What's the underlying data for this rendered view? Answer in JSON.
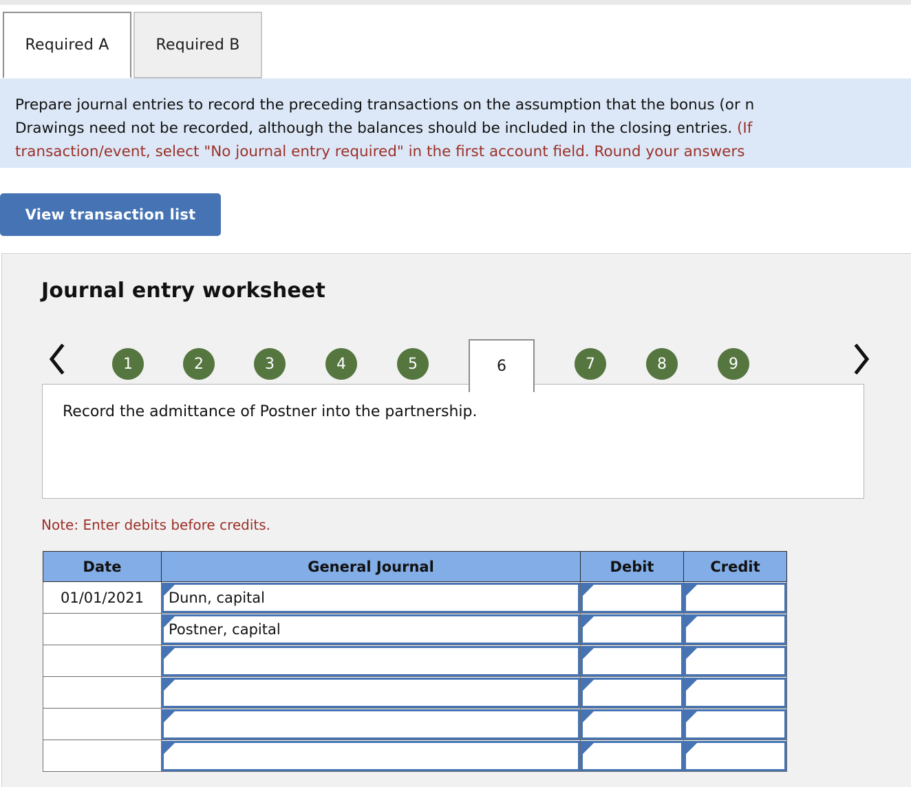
{
  "tabs": [
    {
      "label": "Required A",
      "active": true
    },
    {
      "label": "Required B",
      "active": false
    }
  ],
  "instructions": {
    "line1_plain": "Prepare journal entries to record the preceding transactions on the assumption that the bonus (or n",
    "line2_plain": "Drawings need not be recorded, although the balances should be included in the closing entries. ",
    "line2_highlight": "(If",
    "line3_highlight": "transaction/event, select \"No journal entry required\" in the first account field. Round your answers"
  },
  "toolbar": {
    "view_transaction_list": "View transaction list"
  },
  "worksheet": {
    "title": "Journal entry worksheet",
    "prev_icon": "chevron-left-icon",
    "next_icon": "chevron-right-icon",
    "pages": [
      {
        "label": "1",
        "active": false
      },
      {
        "label": "2",
        "active": false
      },
      {
        "label": "3",
        "active": false
      },
      {
        "label": "4",
        "active": false
      },
      {
        "label": "5",
        "active": false
      },
      {
        "label": "6",
        "active": true
      },
      {
        "label": "7",
        "active": false
      },
      {
        "label": "8",
        "active": false
      },
      {
        "label": "9",
        "active": false
      }
    ],
    "description": "Record the admittance of Postner into the partnership.",
    "note": "Note: Enter debits before credits."
  },
  "journal": {
    "columns": [
      "Date",
      "General Journal",
      "Debit",
      "Credit"
    ],
    "rows": [
      {
        "date": "01/01/2021",
        "account": "Dunn, capital",
        "debit": "",
        "credit": ""
      },
      {
        "date": "",
        "account": "Postner, capital",
        "debit": "",
        "credit": ""
      },
      {
        "date": "",
        "account": "",
        "debit": "",
        "credit": ""
      },
      {
        "date": "",
        "account": "",
        "debit": "",
        "credit": ""
      },
      {
        "date": "",
        "account": "",
        "debit": "",
        "credit": ""
      },
      {
        "date": "",
        "account": "",
        "debit": "",
        "credit": ""
      }
    ]
  },
  "colors": {
    "accent_blue": "#4573b4",
    "header_blue": "#83ade6",
    "banner_blue": "#dce8f7",
    "page_green": "#55763f",
    "note_red": "#9c3028"
  }
}
